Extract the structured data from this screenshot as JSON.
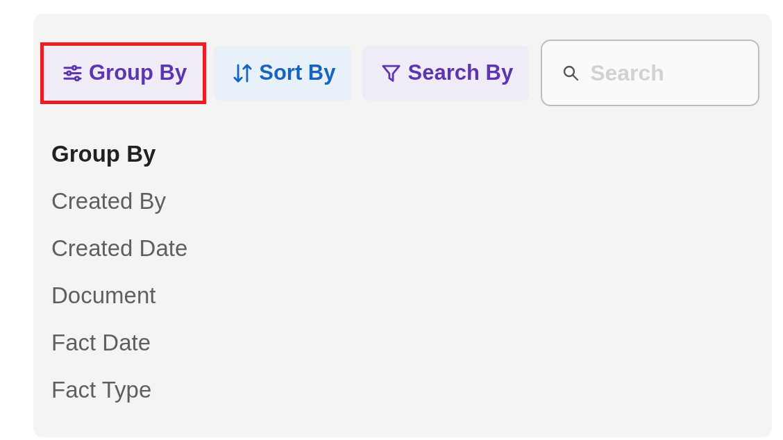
{
  "toolbar": {
    "buttons": [
      {
        "kind": "group",
        "label": "Group By",
        "color": "#5e35b1",
        "highlighted": true
      },
      {
        "kind": "sort",
        "label": "Sort By",
        "color": "#1565c0",
        "highlighted": false
      },
      {
        "kind": "search",
        "label": "Search By",
        "color": "#5e35b1",
        "highlighted": false
      }
    ],
    "search": {
      "placeholder": "Search"
    }
  },
  "group_menu": {
    "title": "Group By",
    "options": [
      "Created By",
      "Created Date",
      "Document",
      "Fact Date",
      "Fact Type"
    ]
  }
}
